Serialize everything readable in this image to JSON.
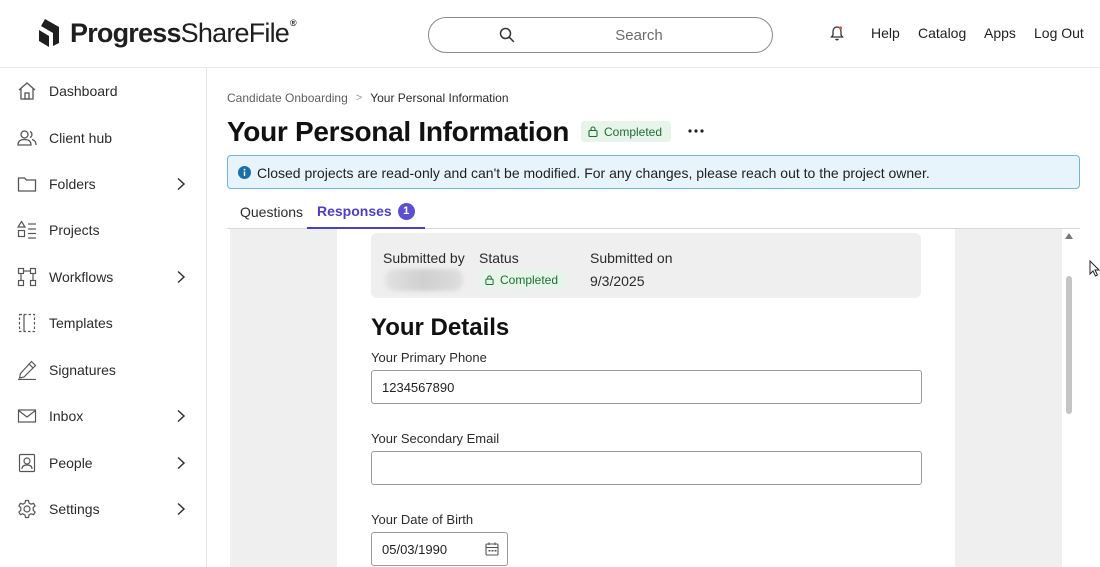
{
  "header": {
    "logo": {
      "brand_bold": "Progress",
      "brand_light": "ShareFile",
      "reg": "®"
    },
    "search": {
      "placeholder": "Search",
      "value": ""
    },
    "nav": [
      "Help",
      "Catalog",
      "Apps",
      "Log Out"
    ],
    "icons": {
      "search": "search-icon",
      "notifications": "bell-icon"
    }
  },
  "sidebar": {
    "items": [
      {
        "label": "Dashboard",
        "icon": "home-icon",
        "has_children": false
      },
      {
        "label": "Client hub",
        "icon": "users-icon",
        "has_children": false
      },
      {
        "label": "Folders",
        "icon": "folder-icon",
        "has_children": true
      },
      {
        "label": "Projects",
        "icon": "projects-icon",
        "has_children": false
      },
      {
        "label": "Workflows",
        "icon": "workflow-icon",
        "has_children": true
      },
      {
        "label": "Templates",
        "icon": "template-icon",
        "has_children": false
      },
      {
        "label": "Signatures",
        "icon": "pen-icon",
        "has_children": false
      },
      {
        "label": "Inbox",
        "icon": "mail-icon",
        "has_children": true
      },
      {
        "label": "People",
        "icon": "person-badge-icon",
        "has_children": true
      },
      {
        "label": "Settings",
        "icon": "gear-icon",
        "has_children": true
      }
    ]
  },
  "breadcrumb": {
    "parent": "Candidate Onboarding",
    "separator": ">",
    "current": "Your Personal Information"
  },
  "page": {
    "title": "Your Personal Information",
    "status": "Completed",
    "alert": "Closed projects are read-only and can't be modified. For any changes, please reach out to the project owner."
  },
  "tabs": [
    {
      "label": "Questions",
      "active": false
    },
    {
      "label": "Responses",
      "active": true,
      "count": "1"
    }
  ],
  "submission": {
    "submitted_by_label": "Submitted by",
    "status_label": "Status",
    "status_value": "Completed",
    "submitted_on_label": "Submitted on",
    "submitted_on_value": "9/3/2025"
  },
  "form": {
    "section_title": "Your Details",
    "primary_phone": {
      "label": "Your Primary Phone",
      "value": "1234567890"
    },
    "secondary_email": {
      "label": "Your Secondary Email",
      "value": ""
    },
    "date_of_birth": {
      "label": "Your Date of Birth",
      "value": "05/03/1990"
    }
  },
  "colors": {
    "accent": "#4b3fc7",
    "success_bg": "#e6f4ea",
    "success_text": "#1e6e34",
    "info_bg": "#e8f4fb",
    "info_border": "#6fb6dc"
  }
}
